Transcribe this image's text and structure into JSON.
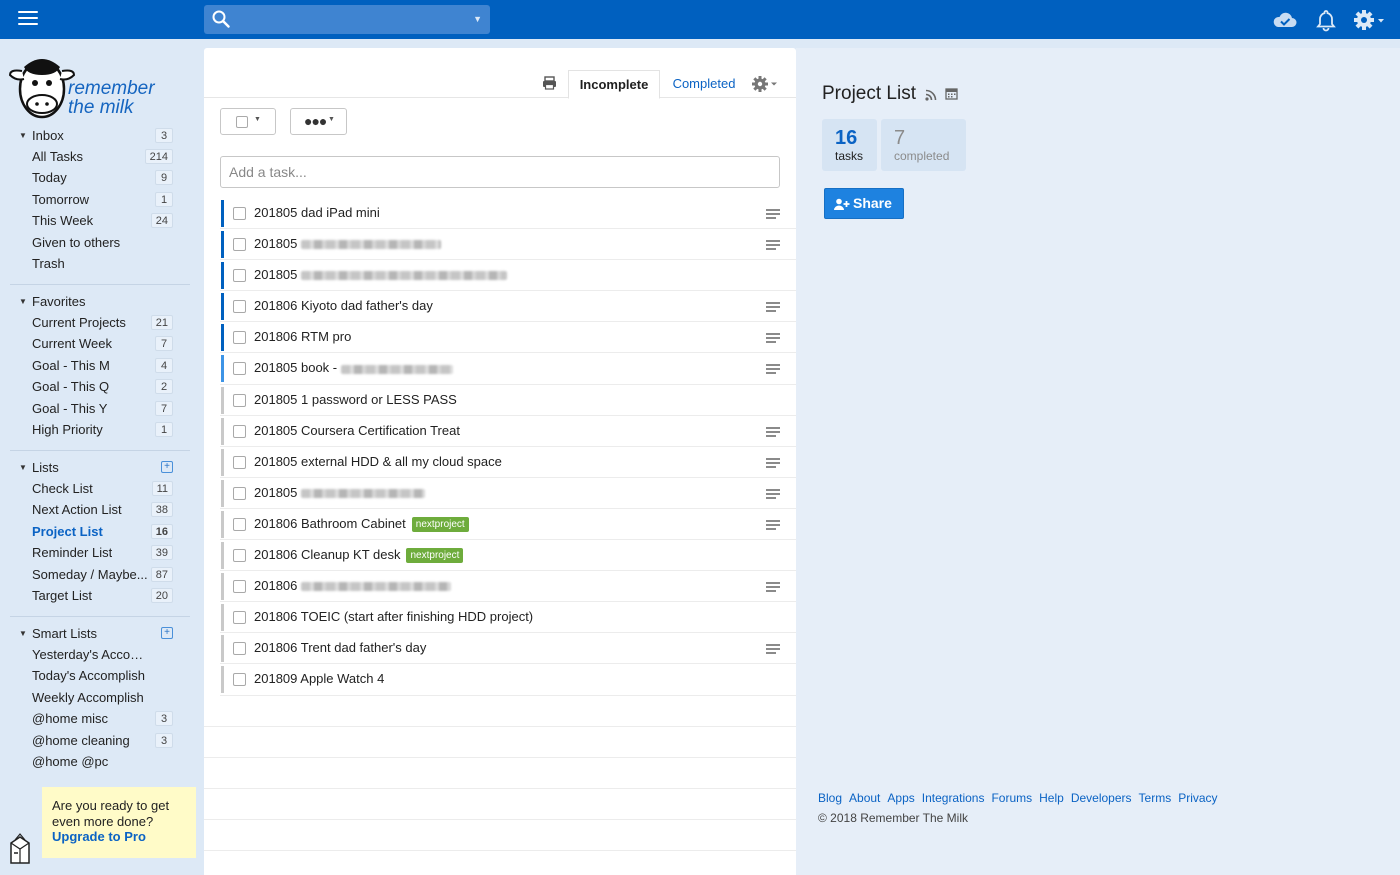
{
  "topbar": {
    "search_placeholder": "",
    "icons": [
      "menu-icon",
      "search-icon",
      "sync-cloud-icon",
      "bell-icon",
      "gear-icon"
    ]
  },
  "sidebar": {
    "logo_text": "remember the milk",
    "inbox": {
      "title": "Inbox",
      "count": "3",
      "items": [
        {
          "label": "All Tasks",
          "count": "214"
        },
        {
          "label": "Today",
          "count": "9"
        },
        {
          "label": "Tomorrow",
          "count": "1"
        },
        {
          "label": "This Week",
          "count": "24"
        },
        {
          "label": "Given to others",
          "count": ""
        },
        {
          "label": "Trash",
          "count": ""
        }
      ]
    },
    "favorites": {
      "title": "Favorites",
      "items": [
        {
          "label": "Current Projects",
          "count": "21"
        },
        {
          "label": "Current Week",
          "count": "7"
        },
        {
          "label": "Goal - This M",
          "count": "4"
        },
        {
          "label": "Goal - This Q",
          "count": "2"
        },
        {
          "label": "Goal - This Y",
          "count": "7"
        },
        {
          "label": "High Priority",
          "count": "1"
        }
      ]
    },
    "lists": {
      "title": "Lists",
      "items": [
        {
          "label": "Check List",
          "count": "11"
        },
        {
          "label": "Next Action List",
          "count": "38"
        },
        {
          "label": "Project List",
          "count": "16",
          "active": true
        },
        {
          "label": "Reminder List",
          "count": "39"
        },
        {
          "label": "Someday / Maybe...",
          "count": "87"
        },
        {
          "label": "Target List",
          "count": "20"
        }
      ]
    },
    "smart_lists": {
      "title": "Smart Lists",
      "items": [
        {
          "label": "Yesterday's Accomp...",
          "count": ""
        },
        {
          "label": "Today's Accomplish",
          "count": ""
        },
        {
          "label": "Weekly Accomplish",
          "count": ""
        },
        {
          "label": "@home misc",
          "count": "3"
        },
        {
          "label": "@home cleaning",
          "count": "3"
        },
        {
          "label": "@home @pc",
          "count": ""
        }
      ]
    },
    "promo": {
      "text": "Are you ready to get even more done?",
      "link": "Upgrade to Pro"
    }
  },
  "center": {
    "tabs": {
      "incomplete": "Incomplete",
      "completed": "Completed"
    },
    "add_task_placeholder": "Add a task...",
    "tasks": [
      {
        "name": "201805 dad iPad mini",
        "priority_color": "#0060bf",
        "note": true,
        "blur": 0,
        "tag": ""
      },
      {
        "name": "201805",
        "priority_color": "#0060bf",
        "note": true,
        "blur": 140,
        "tag": ""
      },
      {
        "name": "201805",
        "priority_color": "#0060bf",
        "note": false,
        "blur": 206,
        "tag": ""
      },
      {
        "name": "201806 Kiyoto dad father's day",
        "priority_color": "#0060bf",
        "note": true,
        "blur": 0,
        "tag": ""
      },
      {
        "name": "201806 RTM pro",
        "priority_color": "#0060bf",
        "note": true,
        "blur": 0,
        "tag": ""
      },
      {
        "name": "201805 book -",
        "priority_color": "#3d94e6",
        "note": true,
        "blur": 112,
        "tag": ""
      },
      {
        "name": "201805 1 password or LESS PASS",
        "priority_color": "#c9c9c9",
        "note": false,
        "blur": 0,
        "tag": ""
      },
      {
        "name": "201805 Coursera Certification Treat",
        "priority_color": "#c9c9c9",
        "note": true,
        "blur": 0,
        "tag": ""
      },
      {
        "name": "201805 external HDD & all my cloud space",
        "priority_color": "#c9c9c9",
        "note": true,
        "blur": 0,
        "tag": ""
      },
      {
        "name": "201805",
        "priority_color": "#c9c9c9",
        "note": true,
        "blur": 124,
        "tag": ""
      },
      {
        "name": "201806 Bathroom Cabinet",
        "priority_color": "#c9c9c9",
        "note": true,
        "blur": 0,
        "tag": "nextproject"
      },
      {
        "name": "201806 Cleanup KT desk",
        "priority_color": "#c9c9c9",
        "note": false,
        "blur": 0,
        "tag": "nextproject"
      },
      {
        "name": "201806",
        "priority_color": "#c9c9c9",
        "note": true,
        "blur": 150,
        "tag": ""
      },
      {
        "name": "201806 TOEIC (start after finishing HDD project)",
        "priority_color": "#c9c9c9",
        "note": false,
        "blur": 0,
        "tag": ""
      },
      {
        "name": "201806 Trent dad father's day",
        "priority_color": "#c9c9c9",
        "note": true,
        "blur": 0,
        "tag": ""
      },
      {
        "name": "201809 Apple Watch 4",
        "priority_color": "#c9c9c9",
        "note": false,
        "blur": 0,
        "tag": ""
      }
    ]
  },
  "right": {
    "title": "Project List",
    "stats": {
      "tasks_count": "16",
      "tasks_label": "tasks",
      "completed_count": "7",
      "completed_label": "completed"
    },
    "share_label": "Share",
    "footer_links": [
      "Blog",
      "About",
      "Apps",
      "Integrations",
      "Forums",
      "Help",
      "Developers",
      "Terms",
      "Privacy"
    ],
    "copyright": "© 2018 Remember The Milk"
  }
}
